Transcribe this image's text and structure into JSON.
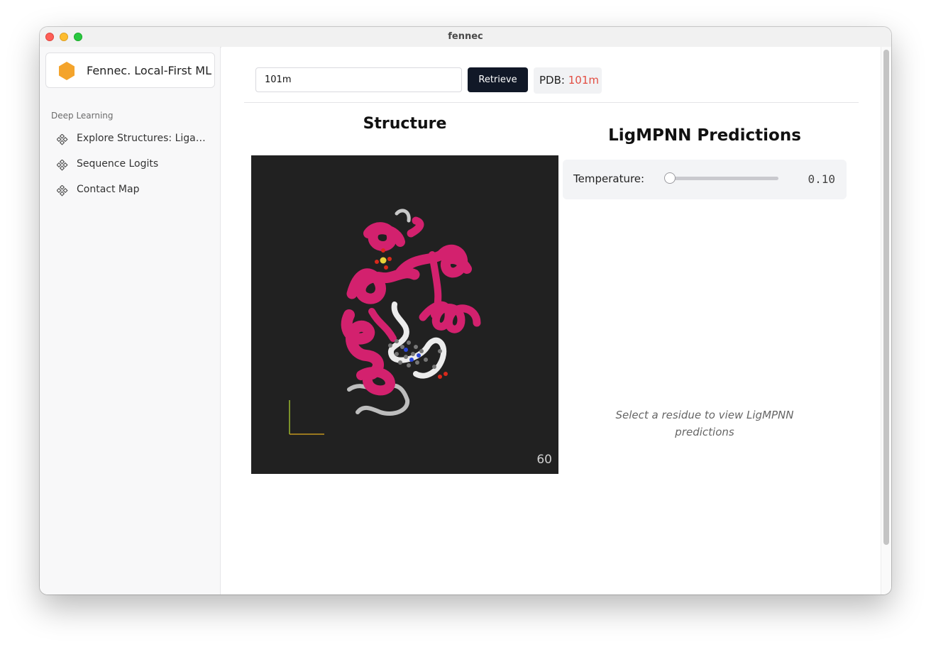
{
  "window": {
    "title": "fennec"
  },
  "sidebar": {
    "brand": "Fennec. Local-First ML",
    "brand_color": "#f4a42c",
    "section": "Deep Learning",
    "items": [
      {
        "label": "Explore Structures: Ligand…",
        "icon": "grid-icon"
      },
      {
        "label": "Sequence Logits",
        "icon": "grid-icon"
      },
      {
        "label": "Contact Map",
        "icon": "grid-icon"
      }
    ]
  },
  "toolbar": {
    "search_value": "101m",
    "retrieve_label": "Retrieve",
    "pdb_prefix": "PDB:",
    "pdb_code": "101m",
    "pdb_color": "#e24d42",
    "button_color": "#111827"
  },
  "structure": {
    "title": "Structure",
    "fps": "60",
    "ribbon_color": "#d3216e",
    "background": "#212121"
  },
  "ligmpnn": {
    "title": "LigMPNN Predictions",
    "temperature_label": "Temperature:",
    "temperature_value": "0.10",
    "empty_message": "Select a residue to view LigMPNN predictions"
  }
}
